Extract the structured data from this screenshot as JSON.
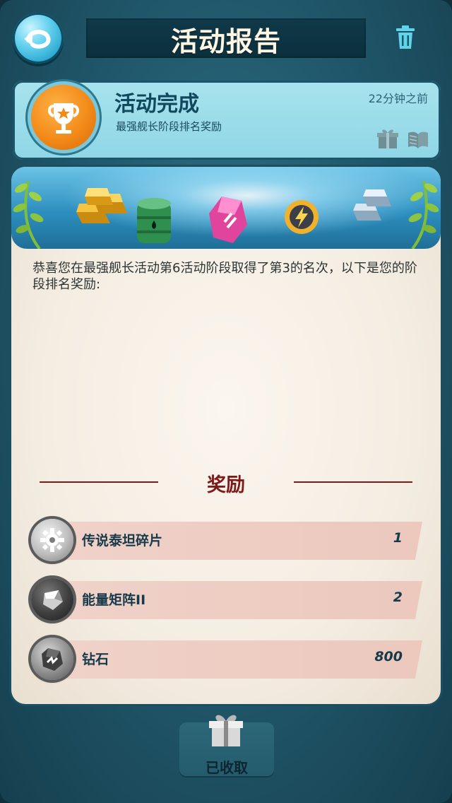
{
  "header": {
    "title": "活动报告",
    "back_icon": "back-arrow-icon",
    "trash_icon": "trash-icon"
  },
  "event": {
    "title": "活动完成",
    "subtitle": "最强舰长阶段排名奖励",
    "time": "22分钟之前",
    "trophy_icon": "trophy-star-icon"
  },
  "message": {
    "text": "恭喜您在最强舰长活动第6活动阶段取得了第3的名次，以下是您的阶段排名奖励:"
  },
  "rewards": {
    "heading": "奖励",
    "items": [
      {
        "name": "传说泰坦碎片",
        "qty": "1",
        "icon": "gear-shard-icon"
      },
      {
        "name": "能量矩阵II",
        "qty": "2",
        "icon": "energy-matrix-icon"
      },
      {
        "name": "钻石",
        "qty": "800",
        "icon": "diamond-icon"
      }
    ]
  },
  "footer": {
    "claimed_label": "已收取",
    "icon": "gift-box-icon"
  },
  "colors": {
    "title_text": "#fff6e4",
    "accent_teal": "#62d0ee",
    "reward_heading": "#7e1a1a",
    "trophy_orange": "#f28a19"
  }
}
